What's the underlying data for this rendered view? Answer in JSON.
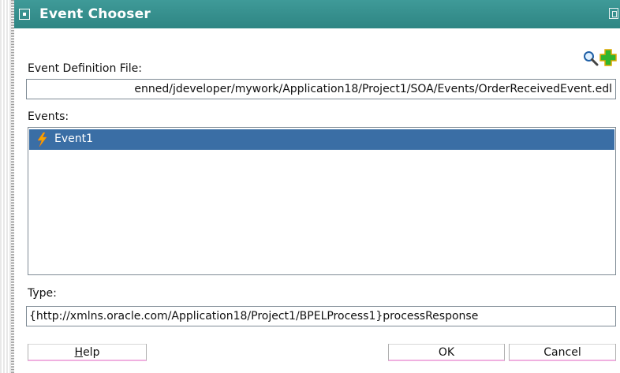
{
  "window": {
    "title": "Event Chooser",
    "title_bar_color": "#2e8583"
  },
  "edl": {
    "label": "Event Definition File:",
    "value": "enned/jdeveloper/mywork/Application18/Project1/SOA/Events/OrderReceivedEvent.edl",
    "search_icon": "magnifier-icon",
    "add_icon": "green-plus-icon"
  },
  "events": {
    "label": "Events:",
    "items": [
      {
        "label": "Event1",
        "icon": "lightning-bolt-icon",
        "selected": true
      }
    ],
    "selection_color": "#3a6ea5"
  },
  "type": {
    "label": "Type:",
    "value": "{http://xmlns.oracle.com/Application18/Project1/BPELProcess1}processResponse"
  },
  "buttons": {
    "help": {
      "mnemonic": "H",
      "rest": "elp"
    },
    "ok": "OK",
    "cancel": "Cancel"
  }
}
